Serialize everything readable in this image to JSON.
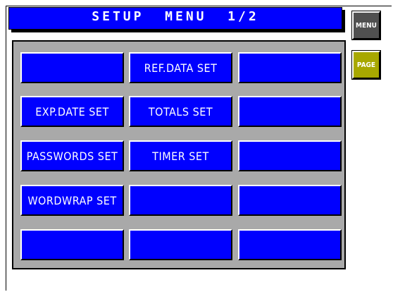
{
  "header": {
    "title": "SETUP  MENU  1/2"
  },
  "side_buttons": {
    "menu_label": "MENU",
    "page_label": "PAGE"
  },
  "grid": {
    "r0c0": "",
    "r0c1": "REF.DATA SET",
    "r0c2": "",
    "r1c0": "EXP.DATE SET",
    "r1c1": "TOTALS SET",
    "r1c2": "",
    "r2c0": "PASSWORDS SET",
    "r2c1": "TIMER SET",
    "r2c2": "",
    "r3c0": "WORDWRAP SET",
    "r3c1": "",
    "r3c2": "",
    "r4c0": "",
    "r4c1": "",
    "r4c2": ""
  },
  "colors": {
    "title_bar": "#0000ff",
    "button": "#0000ff",
    "panel": "#a9a9a9",
    "menu_button": "#505050",
    "page_button": "#a8a800"
  }
}
